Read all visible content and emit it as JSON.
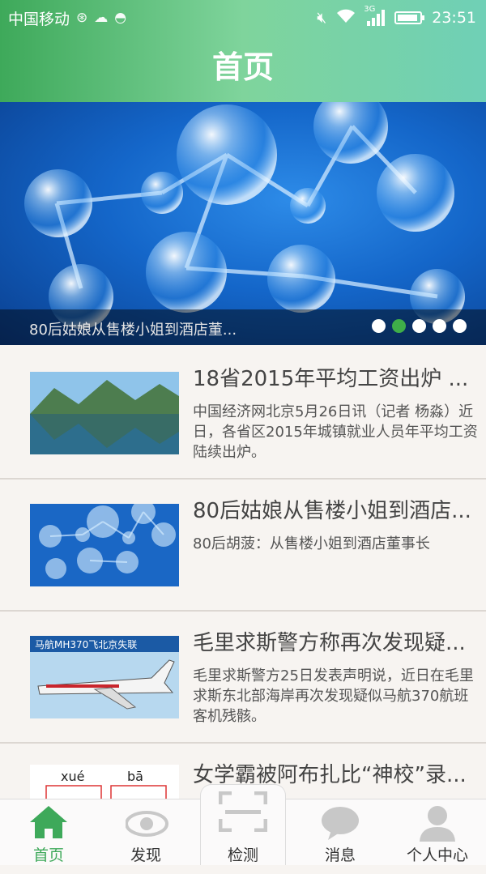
{
  "status": {
    "carrier": "中国移动",
    "net": "3G",
    "time": "23:51"
  },
  "header": {
    "title": "首页"
  },
  "banner": {
    "caption": "80后姑娘从售楼小姐到酒店董...",
    "active_dot": 1
  },
  "news": [
    {
      "title": "18省2015年平均工资出炉 ...",
      "desc": "中国经济网北京5月26日讯（记者 杨淼）近日，各省区2015年城镇就业人员年平均工资陆续出炉。",
      "thumb": "lake-landscape"
    },
    {
      "title": "80后姑娘从售楼小姐到酒店...",
      "desc": "80后胡菠：从售楼小姐到酒店董事长",
      "thumb": "molecule-bubbles"
    },
    {
      "title": "毛里求斯警方称再次发现疑...",
      "desc": "毛里求斯警方25日发表声明说，近日在毛里求斯东北部海岸再次发现疑似马航370航班客机残骸。",
      "thumb": "airplane",
      "thumb_text": "马航MH370飞北京失联"
    },
    {
      "title": "女学霸被阿布扎比“神校”录...",
      "desc": "",
      "thumb": "pinyin-card",
      "thumb_text": [
        "xué",
        "bā"
      ]
    }
  ],
  "tabs": [
    {
      "label": "首页",
      "icon": "home-icon",
      "active": true
    },
    {
      "label": "发现",
      "icon": "eye-icon",
      "active": false
    },
    {
      "label": "检测",
      "icon": "scan-icon",
      "active": false
    },
    {
      "label": "消息",
      "icon": "chat-icon",
      "active": false
    },
    {
      "label": "个人中心",
      "icon": "person-icon",
      "active": false
    }
  ],
  "colors": {
    "accent": "#3ea95a",
    "header_gradient": [
      "#3ea95a",
      "#6fd0b6"
    ]
  }
}
